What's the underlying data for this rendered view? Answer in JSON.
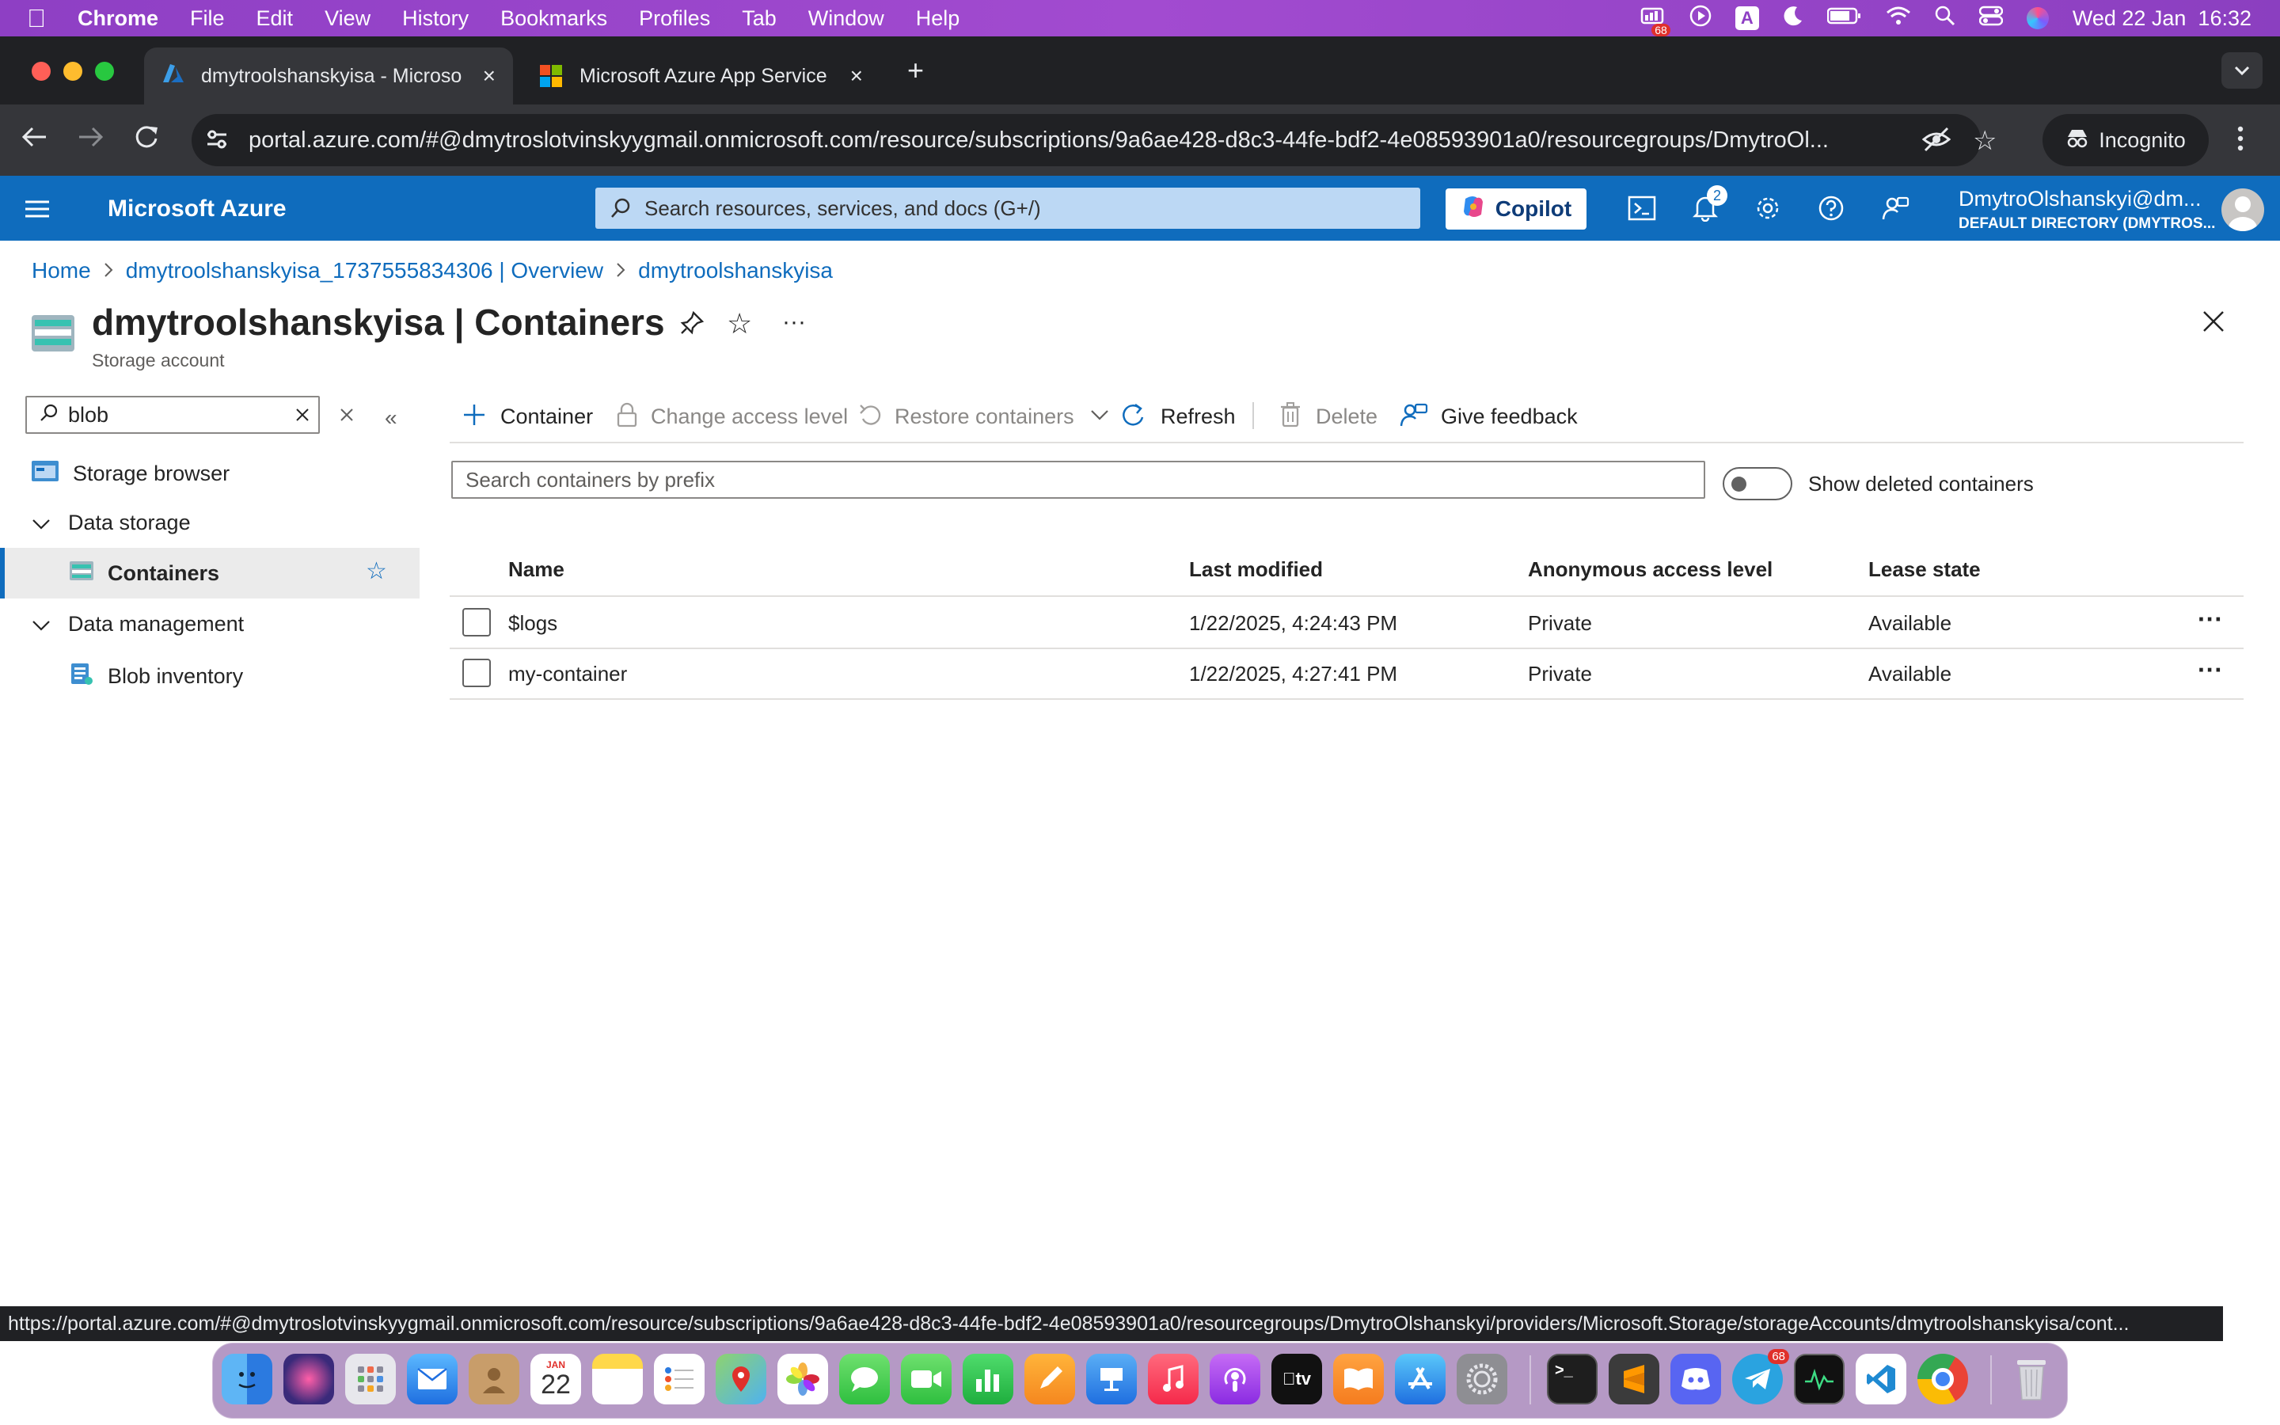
{
  "menubar": {
    "app": "Chrome",
    "items": [
      "File",
      "Edit",
      "View",
      "History",
      "Bookmarks",
      "Profiles",
      "Tab",
      "Window",
      "Help"
    ],
    "badge": "68",
    "datetime": "Wed 22 Jan  16:32"
  },
  "browser": {
    "tabs": [
      {
        "title": "dmytroolshanskyisa - Microso",
        "active": true
      },
      {
        "title": "Microsoft Azure App Service",
        "active": false
      }
    ],
    "url": "portal.azure.com/#@dmytroslotvinskyygmail.onmicrosoft.com/resource/subscriptions/9a6ae428-d8c3-44fe-bdf2-4e08593901a0/resourcegroups/DmytroOl...",
    "incognito_label": "Incognito",
    "status_url": "https://portal.azure.com/#@dmytroslotvinskyygmail.onmicrosoft.com/resource/subscriptions/9a6ae428-d8c3-44fe-bdf2-4e08593901a0/resourcegroups/DmytroOlshanskyi/providers/Microsoft.Storage/storageAccounts/dmytroolshanskyisa/cont..."
  },
  "azure": {
    "brand": "Microsoft Azure",
    "search_placeholder": "Search resources, services, and docs (G+/)",
    "copilot_label": "Copilot",
    "notification_count": "2",
    "user_name": "DmytroOlshanskyi@dm...",
    "user_directory": "DEFAULT DIRECTORY (DMYTROS..."
  },
  "breadcrumb": [
    "Home",
    "dmytroolshanskyisa_1737555834306 | Overview",
    "dmytroolshanskyisa"
  ],
  "page": {
    "title": "dmytroolshanskyisa | Containers",
    "subtitle": "Storage account"
  },
  "sidebar": {
    "filter_value": "blob",
    "items": [
      {
        "label": "Storage browser",
        "level": 0
      },
      {
        "label": "Data storage",
        "level": 0,
        "group": true
      },
      {
        "label": "Containers",
        "level": 1,
        "selected": true
      },
      {
        "label": "Data management",
        "level": 0,
        "group": true
      },
      {
        "label": "Blob inventory",
        "level": 1
      }
    ]
  },
  "commands": {
    "container": "Container",
    "change_access": "Change access level",
    "restore": "Restore containers",
    "refresh": "Refresh",
    "delete": "Delete",
    "feedback": "Give feedback"
  },
  "filter": {
    "placeholder": "Search containers by prefix",
    "toggle_label": "Show deleted containers"
  },
  "table": {
    "columns": [
      "Name",
      "Last modified",
      "Anonymous access level",
      "Lease state"
    ],
    "rows": [
      {
        "name": "$logs",
        "modified": "1/22/2025, 4:24:43 PM",
        "access": "Private",
        "lease": "Available"
      },
      {
        "name": "my-container",
        "modified": "1/22/2025, 4:27:41 PM",
        "access": "Private",
        "lease": "Available"
      }
    ]
  },
  "dock": {
    "calendar_month": "JAN",
    "calendar_day": "22",
    "telegram_badge": "68"
  },
  "colors": {
    "azure_blue": "#0f6cbd",
    "menubar_purple": "#9a45c9",
    "chrome_dark": "#202124"
  }
}
